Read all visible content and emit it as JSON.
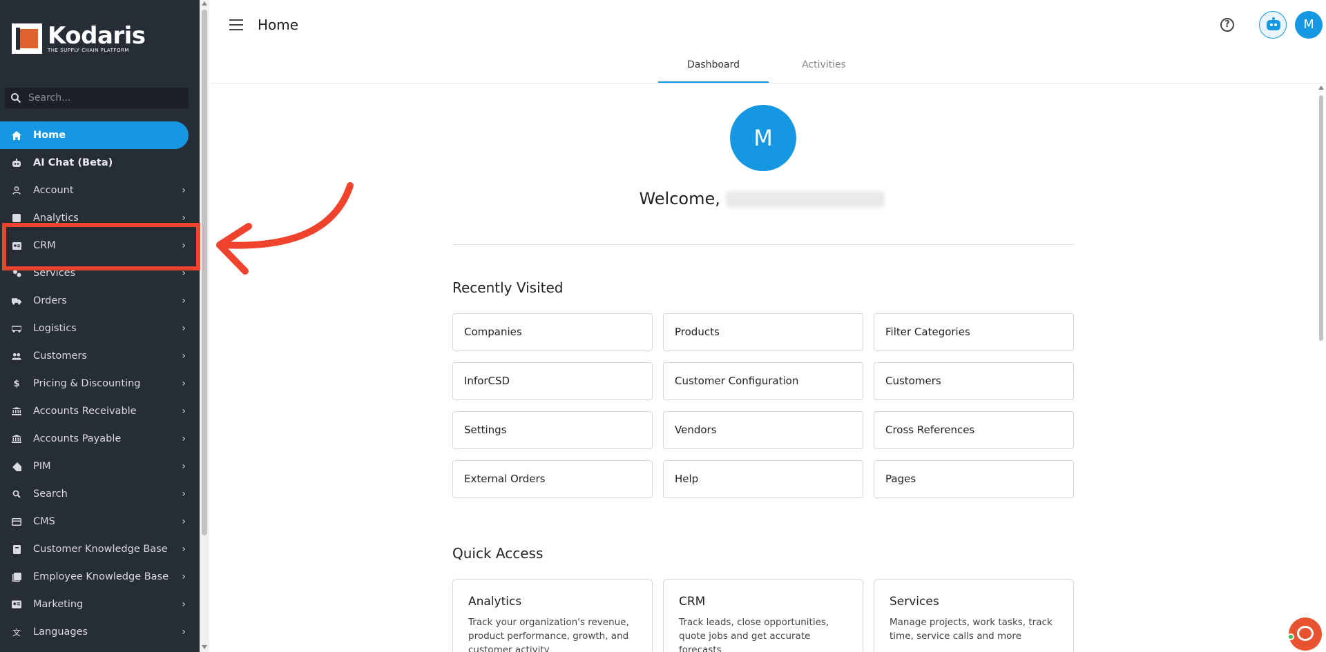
{
  "brand": {
    "name": "Kodaris",
    "tagline": "THE SUPPLY CHAIN PLATFORM",
    "accent": "#1597e2",
    "logo_orange": "#e2622d"
  },
  "sidebar": {
    "search_placeholder": "Search...",
    "items": [
      {
        "label": "Home",
        "icon": "home-icon",
        "active": true,
        "chevron": false
      },
      {
        "label": "AI Chat (Beta)",
        "icon": "robot-icon",
        "chevron": false
      },
      {
        "label": "Account",
        "icon": "person-icon",
        "chevron": true
      },
      {
        "label": "Analytics",
        "icon": "chart-icon",
        "chevron": true
      },
      {
        "label": "CRM",
        "icon": "contact-card-icon",
        "chevron": true
      },
      {
        "label": "Services",
        "icon": "services-icon",
        "chevron": true
      },
      {
        "label": "Orders",
        "icon": "truck-icon",
        "chevron": true
      },
      {
        "label": "Logistics",
        "icon": "logistics-icon",
        "chevron": true
      },
      {
        "label": "Customers",
        "icon": "people-icon",
        "chevron": true
      },
      {
        "label": "Pricing & Discounting",
        "icon": "dollar-icon",
        "chevron": true
      },
      {
        "label": "Accounts Receivable",
        "icon": "bank-icon",
        "chevron": true
      },
      {
        "label": "Accounts Payable",
        "icon": "bank-icon",
        "chevron": true
      },
      {
        "label": "PIM",
        "icon": "tag-icon",
        "chevron": true
      },
      {
        "label": "Search",
        "icon": "search-icon",
        "chevron": true
      },
      {
        "label": "CMS",
        "icon": "cms-icon",
        "chevron": true
      },
      {
        "label": "Customer Knowledge Base",
        "icon": "book-icon",
        "chevron": true
      },
      {
        "label": "Employee Knowledge Base",
        "icon": "book-icon",
        "chevron": true
      },
      {
        "label": "Marketing",
        "icon": "megaphone-icon",
        "chevron": true
      },
      {
        "label": "Languages",
        "icon": "translate-icon",
        "chevron": true
      }
    ]
  },
  "header": {
    "title": "Home",
    "avatar_initial": "M",
    "help_glyph": "?",
    "tabs": [
      {
        "label": "Dashboard",
        "active": true
      },
      {
        "label": "Activities",
        "active": false
      }
    ]
  },
  "main": {
    "avatar_initial": "M",
    "welcome_text": "Welcome,",
    "recently_visited_title": "Recently Visited",
    "recently_visited": [
      "Companies",
      "Products",
      "Filter Categories",
      "InforCSD",
      "Customer Configuration",
      "Customers",
      "Settings",
      "Vendors",
      "Cross References",
      "External Orders",
      "Help",
      "Pages"
    ],
    "quick_access_title": "Quick Access",
    "quick_access": [
      {
        "title": "Analytics",
        "desc": "Track your organization's revenue, product performance, growth, and customer activity"
      },
      {
        "title": "CRM",
        "desc": "Track leads, close opportunities, quote jobs and get accurate forecasts"
      },
      {
        "title": "Services",
        "desc": "Manage projects, work tasks, track time, service calls and more"
      }
    ]
  }
}
